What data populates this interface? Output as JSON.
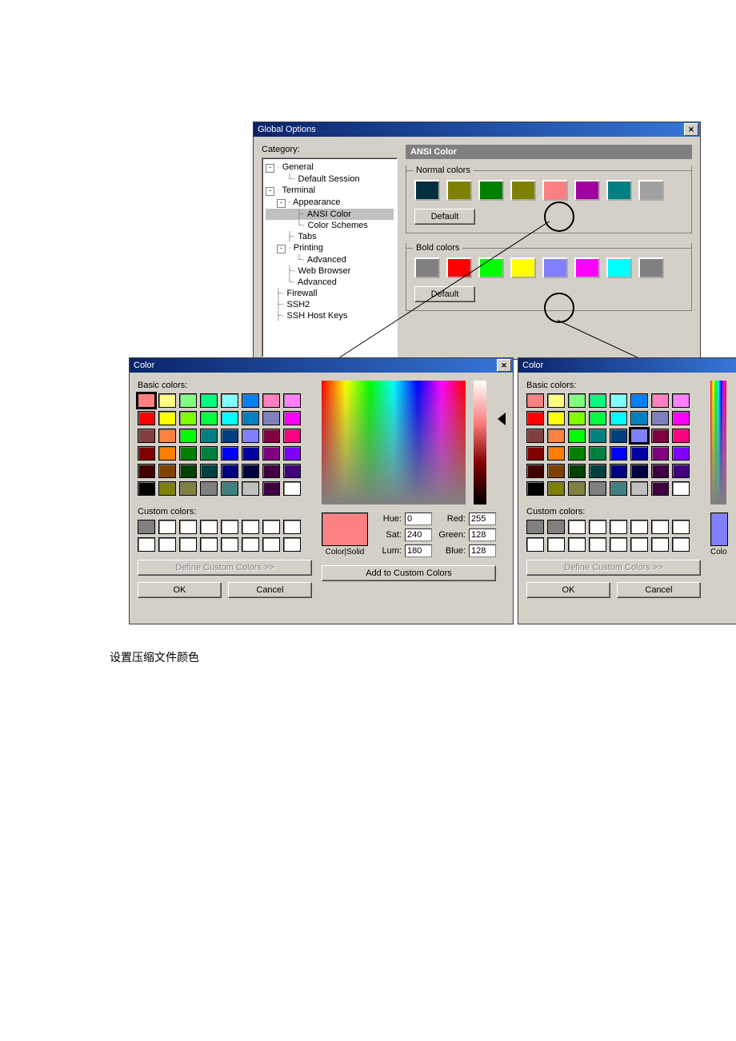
{
  "globalOptions": {
    "title": "Global Options",
    "categoryLabel": "Category:",
    "tree": {
      "general": "General",
      "defaultSession": "Default Session",
      "terminal": "Terminal",
      "appearance": "Appearance",
      "ansiColor": "ANSI Color",
      "colorSchemes": "Color Schemes",
      "tabs": "Tabs",
      "printing": "Printing",
      "advanced": "Advanced",
      "webBrowser": "Web Browser",
      "advanced2": "Advanced",
      "firewall": "Firewall",
      "ssh2": "SSH2",
      "sshHostKeys": "SSH Host Keys"
    },
    "panelTitle": "ANSI Color",
    "normalColors": {
      "legend": "Normal colors",
      "defaultBtn": "Default",
      "colors": [
        "#003040",
        "#808000",
        "#008000",
        "#808000",
        "#ff8080",
        "#a000a0",
        "#008080",
        "#a0a0a0"
      ]
    },
    "boldColors": {
      "legend": "Bold colors",
      "defaultBtn": "Default",
      "colors": [
        "#808080",
        "#ff0000",
        "#00ff00",
        "#ffff00",
        "#8080ff",
        "#ff00ff",
        "#00ffff",
        "#808080"
      ]
    }
  },
  "colorDialog1": {
    "title": "Color",
    "basicLabel": "Basic colors:",
    "customLabel": "Custom colors:",
    "defineBtn": "Define Custom Colors >>",
    "okBtn": "OK",
    "cancelBtn": "Cancel",
    "addBtn": "Add to Custom Colors",
    "colorSolidLabel": "Color|Solid",
    "hueLabel": "Hue:",
    "satLabel": "Sat:",
    "lumLabel": "Lum:",
    "redLabel": "Red:",
    "greenLabel": "Green:",
    "blueLabel": "Blue:",
    "hue": "0",
    "sat": "240",
    "lum": "180",
    "red": "255",
    "green": "128",
    "blue": "128",
    "solidColor": "#ff8080",
    "basicColors": [
      "#ff8080",
      "#ffff80",
      "#80ff80",
      "#00ff80",
      "#80ffff",
      "#0080ff",
      "#ff80c0",
      "#ff80ff",
      "#ff0000",
      "#ffff00",
      "#80ff00",
      "#00ff40",
      "#00ffff",
      "#0080c0",
      "#8080c0",
      "#ff00ff",
      "#804040",
      "#ff8040",
      "#00ff00",
      "#008080",
      "#004080",
      "#8080ff",
      "#800040",
      "#ff0080",
      "#800000",
      "#ff8000",
      "#008000",
      "#008040",
      "#0000ff",
      "#0000a0",
      "#800080",
      "#8000ff",
      "#400000",
      "#804000",
      "#004000",
      "#004040",
      "#000080",
      "#000040",
      "#400040",
      "#400080",
      "#000000",
      "#808000",
      "#808040",
      "#808080",
      "#408080",
      "#c0c0c0",
      "#400040",
      "#ffffff"
    ],
    "customSlots": [
      "#808080",
      "#ffffff",
      "#ffffff",
      "#ffffff",
      "#ffffff",
      "#ffffff",
      "#ffffff",
      "#ffffff",
      "#ffffff",
      "#ffffff",
      "#ffffff",
      "#ffffff",
      "#ffffff",
      "#ffffff",
      "#ffffff",
      "#ffffff"
    ],
    "selectedIndex": 0
  },
  "colorDialog2": {
    "title": "Color",
    "basicLabel": "Basic colors:",
    "customLabel": "Custom colors:",
    "defineBtn": "Define Custom Colors >>",
    "okBtn": "OK",
    "cancelBtn": "Cancel",
    "colorSolidLabel": "Colo",
    "basicColors": [
      "#ff8080",
      "#ffff80",
      "#80ff80",
      "#00ff80",
      "#80ffff",
      "#0080ff",
      "#ff80c0",
      "#ff80ff",
      "#ff0000",
      "#ffff00",
      "#80ff00",
      "#00ff40",
      "#00ffff",
      "#0080c0",
      "#8080c0",
      "#ff00ff",
      "#804040",
      "#ff8040",
      "#00ff00",
      "#008080",
      "#004080",
      "#8080ff",
      "#800040",
      "#ff0080",
      "#800000",
      "#ff8000",
      "#008000",
      "#008040",
      "#0000ff",
      "#0000a0",
      "#800080",
      "#8000ff",
      "#400000",
      "#804000",
      "#004000",
      "#004040",
      "#000080",
      "#000040",
      "#400040",
      "#400080",
      "#000000",
      "#808000",
      "#808040",
      "#808080",
      "#408080",
      "#c0c0c0",
      "#400040",
      "#ffffff"
    ],
    "customSlots": [
      "#808080",
      "#808080",
      "#ffffff",
      "#ffffff",
      "#ffffff",
      "#ffffff",
      "#ffffff",
      "#ffffff",
      "#ffffff",
      "#ffffff",
      "#ffffff",
      "#ffffff",
      "#ffffff",
      "#ffffff",
      "#ffffff",
      "#ffffff"
    ],
    "selectedIndex": 21,
    "solidColor": "#8080ff"
  },
  "caption": "设置压缩文件颜色"
}
